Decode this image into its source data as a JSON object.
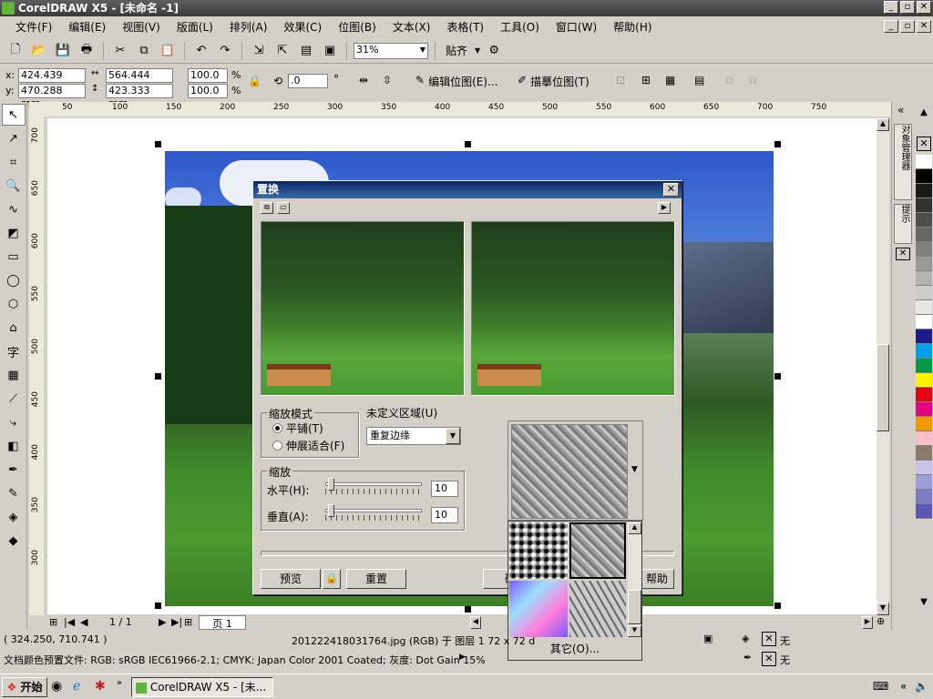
{
  "app": {
    "title": "CorelDRAW X5 - [未命名 -1]"
  },
  "menu": [
    "文件(F)",
    "编辑(E)",
    "视图(V)",
    "版面(L)",
    "排列(A)",
    "效果(C)",
    "位图(B)",
    "文本(X)",
    "表格(T)",
    "工具(O)",
    "窗口(W)",
    "帮助(H)"
  ],
  "toolbar": {
    "zoom": "31%",
    "snap_label": "贴齐"
  },
  "props": {
    "x": "424.439 mm",
    "y": "470.288 mm",
    "w": "564.444 mm",
    "h": "423.333 mm",
    "sx": "100.0",
    "sy": "100.0",
    "pct": "%",
    "rot": ".0",
    "deg": "°",
    "edit_bitmap": "编辑位图(E)...",
    "trace_bitmap": "描摹位图(T)"
  },
  "ruler": {
    "h": [
      "50",
      "100",
      "150",
      "200",
      "250",
      "300",
      "350",
      "400",
      "450",
      "500",
      "550",
      "600",
      "650",
      "700",
      "750"
    ],
    "v": [
      "700",
      "650",
      "600",
      "550",
      "500",
      "450",
      "400",
      "350",
      "300"
    ]
  },
  "dialog": {
    "title": "置换",
    "scale_mode_label": "缩放模式",
    "tile": "平铺(T)",
    "stretch": "伸展适合(F)",
    "undef_label": "未定义区域(U)",
    "undef_value": "重复边缘",
    "scale_label": "缩放",
    "horizontal": "水平(H):",
    "vertical": "垂直(A):",
    "h_value": "10",
    "v_value": "10",
    "preview_btn": "预览",
    "reset_btn": "重置",
    "ok_btn": "确",
    "help_btn": "帮助"
  },
  "popup": {
    "other": "其它(O)..."
  },
  "pages": {
    "counter": "1 / 1",
    "tab": "页 1"
  },
  "docker_tabs": [
    "对象管理器",
    "提示"
  ],
  "palette": [
    "#ffffff",
    "#000000",
    "#1a1a1a",
    "#333333",
    "#4d4d4d",
    "#666666",
    "#808080",
    "#999999",
    "#b3b3b3",
    "#cccccc",
    "#e6e6e6",
    "#ffffff",
    "#1c1c8c",
    "#00a0e9",
    "#009944",
    "#fff100",
    "#e60012",
    "#e4007f",
    "#f39800",
    "#f7c0c8",
    "#8a7b6a",
    "#c9c3e6",
    "#9c9cd6",
    "#7b7bc6",
    "#5a5ab6"
  ],
  "status": {
    "coords": "( 324.250, 710.741 )",
    "object": "201222418031764.jpg (RGB) 于 图层 1 72 x 72 d",
    "profile": "文档颜色预置文件: RGB: sRGB IEC61966-2.1; CMYK: Japan Color 2001 Coated; 灰度: Dot Gain 15%",
    "fill_none": "无",
    "outline_none": "无"
  },
  "taskbar": {
    "start": "开始",
    "task": "CorelDRAW X5 - [未..."
  }
}
